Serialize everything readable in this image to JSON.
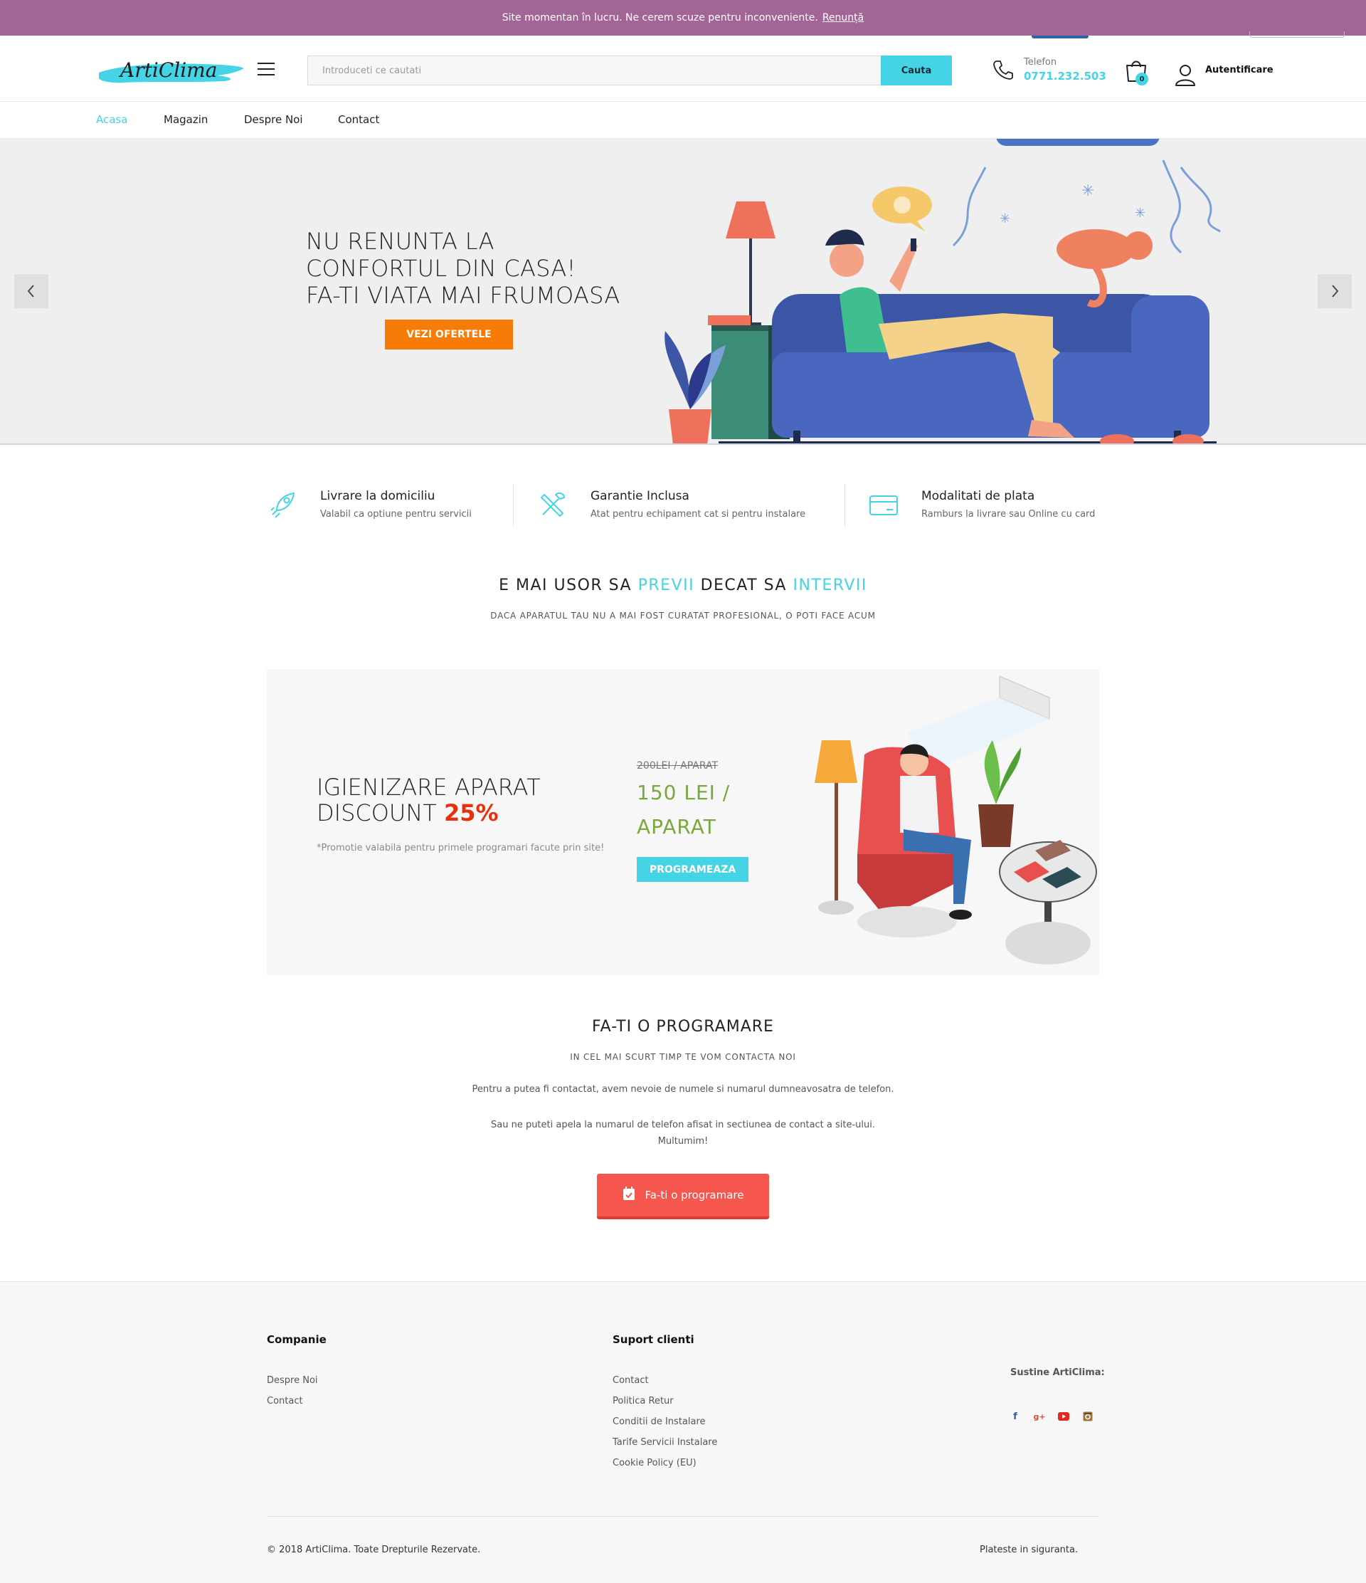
{
  "notice": {
    "text": "Site momentan în lucru. Ne cerem scuze pentru inconveniente.",
    "dismiss": "Renunță"
  },
  "header": {
    "logo_text": "ArtiClima",
    "search_placeholder": "Introduceti ce cautati",
    "search_button": "Cauta",
    "phone_label": "Telefon",
    "phone_number": "0771.232.503",
    "cart_count": "0",
    "login": "Autentificare"
  },
  "nav": {
    "items": [
      "Acasa",
      "Magazin",
      "Despre Noi",
      "Contact"
    ],
    "active": "Acasa"
  },
  "hero": {
    "lines": [
      "NU RENUNTA LA",
      "CONFORTUL DIN CASA!",
      "FA-TI VIATA MAI FRUMOASA"
    ],
    "cta": "VEZI OFERTELE"
  },
  "features": [
    {
      "title": "Livrare la domiciliu",
      "subtitle": "Valabil ca optiune pentru servicii",
      "icon": "rocket-icon"
    },
    {
      "title": "Garantie Inclusa",
      "subtitle": "Atat pentru echipament cat si pentru instalare",
      "icon": "tools-icon"
    },
    {
      "title": "Modalitati de plata",
      "subtitle": "Ramburs la livrare sau Online cu card",
      "icon": "credit-card-icon"
    }
  ],
  "tagline": {
    "part1": "E MAI USOR SA ",
    "highlight1": "PREVII",
    "part2": " DECAT SA ",
    "highlight2": "INTERVII",
    "subtitle": "DACA APARATUL TAU NU A MAI FOST CURATAT PROFESIONAL, O POTI FACE ACUM"
  },
  "promo": {
    "title_line1": "IGIENIZARE APARAT",
    "title_line2": "DISCOUNT ",
    "discount": "25%",
    "note": "*Promotie valabila pentru primele programari facute prin site!",
    "old_price": "200LEI / APARAT",
    "new_price": "150 LEI / APARAT",
    "button": "PROGRAMEAZA"
  },
  "appointment": {
    "title": "FA-TI O PROGRAMARE",
    "subtitle": "IN CEL MAI SCURT TIMP TE VOM CONTACTA NOI",
    "p1": "Pentru a putea fi contactat, avem nevoie de numele si numarul dumneavosatra de telefon.",
    "p2_line1": "Sau ne puteti apela la numarul de telefon afisat in sectiunea de contact a site-ului.",
    "p2_line2": "Multumim!",
    "button": "Fa-ti o programare"
  },
  "footer": {
    "company_heading": "Companie",
    "company_links": [
      "Despre Noi",
      "Contact"
    ],
    "support_heading": "Suport clienti",
    "support_links": [
      "Contact",
      "Politica Retur",
      "Conditii de Instalare",
      "Tarife Servicii Instalare",
      "Cookie Policy (EU)"
    ],
    "support_label": "Sustine ArtiClima:",
    "social": [
      "facebook-icon",
      "google-plus-icon",
      "youtube-icon",
      "instagram-icon"
    ],
    "copyright": "© 2018 ArtiClima. Toate Drepturile Rezervate.",
    "pay": "Plateste in siguranta."
  },
  "colors": {
    "accent": "#45d3e6",
    "notice": "#a36595",
    "cta_orange": "#f77b07",
    "appointment_red": "#f5564e",
    "discount_red": "#e8310c",
    "price_green": "#79a83d"
  }
}
